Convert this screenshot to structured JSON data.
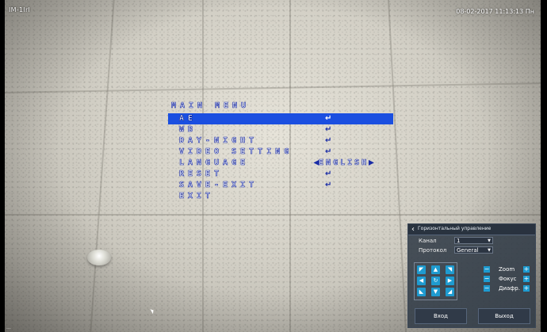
{
  "camera": {
    "name": "IM-1lrl",
    "datetime": "08-02-2017 11:13:13 Пн",
    "bottom_label": "..."
  },
  "osd_menu": {
    "title": "MAIN MENU",
    "items": [
      {
        "label": "AE",
        "selected": true,
        "action": "↵"
      },
      {
        "label": "WB",
        "selected": false,
        "action": "↵"
      },
      {
        "label": "DAY-NIGHT",
        "selected": false,
        "action": "↵"
      },
      {
        "label": "VIDEO SETTING",
        "selected": false,
        "action": "↵"
      },
      {
        "label": "LANGUAGE",
        "selected": false,
        "value": "ENGLISH"
      },
      {
        "label": "RESET",
        "selected": false,
        "action": "↵"
      },
      {
        "label": "SAVE-EXIT",
        "selected": false,
        "action": "↵"
      },
      {
        "label": "EXIT",
        "selected": false
      }
    ],
    "highlight_color": "#1b4fe0"
  },
  "ptz_panel": {
    "title": "Горизонтальный управление",
    "channel_label": "Канал",
    "channel_value": "1",
    "protocol_label": "Протокол",
    "protocol_value": "General",
    "lens": [
      {
        "label": "Zoom",
        "minus": "−",
        "plus": "+"
      },
      {
        "label": "Фокус",
        "minus": "−",
        "plus": "+"
      },
      {
        "label": "Диафр.",
        "minus": "−",
        "plus": "+"
      }
    ],
    "dpad": {
      "up": "▲",
      "down": "▼",
      "left": "◀",
      "right": "▶",
      "center": "↻",
      "up_left": "◤",
      "up_right": "◥",
      "down_left": "◣",
      "down_right": "◢"
    },
    "enter_button": "Вход",
    "exit_button": "Выход",
    "accent_color": "#1e9bd0"
  }
}
